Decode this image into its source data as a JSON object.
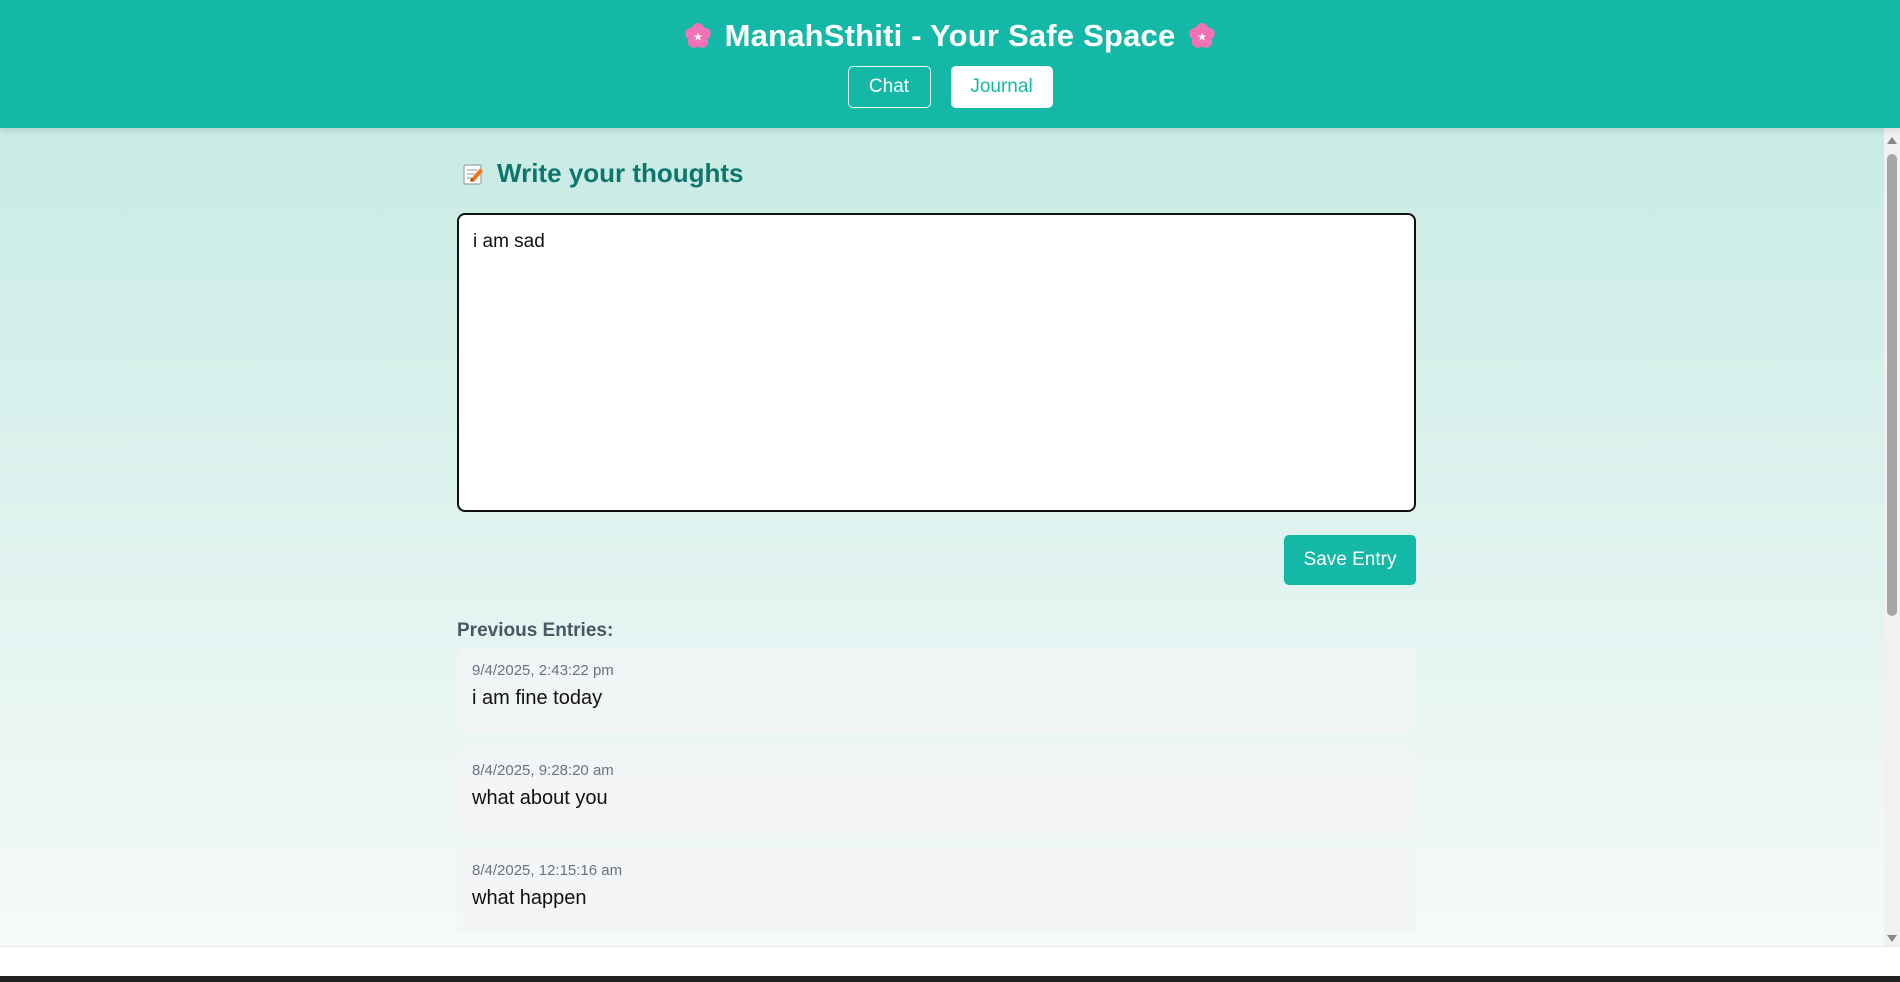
{
  "header": {
    "title": "ManahSthiti - Your Safe Space",
    "left_icon": "cherry-blossom",
    "right_icon": "cherry-blossom",
    "nav": [
      {
        "label": "Chat",
        "active": false
      },
      {
        "label": "Journal",
        "active": true
      }
    ]
  },
  "journal": {
    "heading": "Write your thoughts",
    "heading_icon": "memo",
    "input_value": "i am sad",
    "save_label": "Save Entry",
    "previous_label": "Previous Entries:",
    "entries": [
      {
        "timestamp": "9/4/2025, 2:43:22 pm",
        "text": "i am fine today"
      },
      {
        "timestamp": "8/4/2025, 9:28:20 am",
        "text": "what about you"
      },
      {
        "timestamp": "8/4/2025, 12:15:16 am",
        "text": "what happen"
      }
    ]
  },
  "colors": {
    "accent": "#14b8a6",
    "heading": "#0f766e",
    "flower": "#f472b6"
  }
}
